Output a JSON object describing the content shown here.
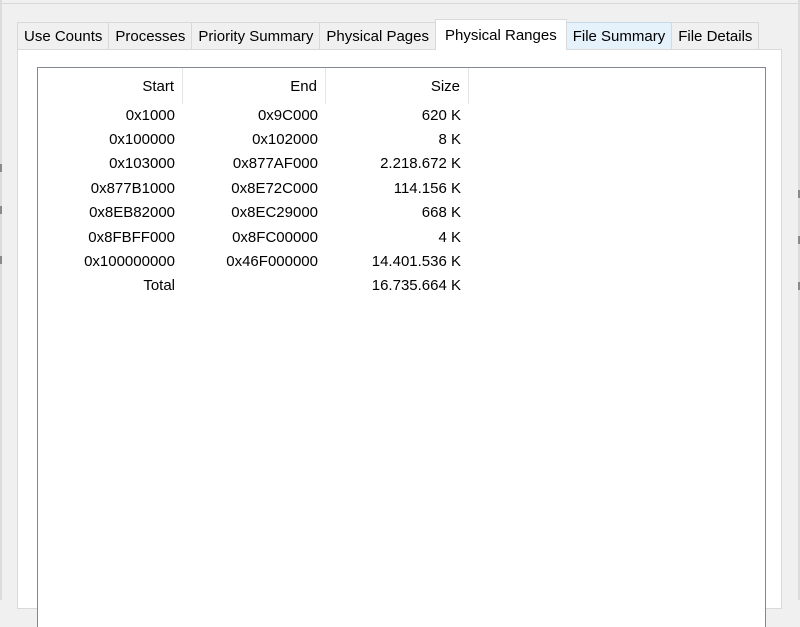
{
  "tabs": [
    {
      "label": "Use Counts"
    },
    {
      "label": "Processes"
    },
    {
      "label": "Priority Summary"
    },
    {
      "label": "Physical Pages"
    },
    {
      "label": "Physical Ranges"
    },
    {
      "label": "File Summary"
    },
    {
      "label": "File Details"
    }
  ],
  "active_tab": "Physical Ranges",
  "hover_tab": "File Summary",
  "table": {
    "columns": [
      "Start",
      "End",
      "Size"
    ],
    "rows": [
      [
        "0x1000",
        "0x9C000",
        "620 K"
      ],
      [
        "0x100000",
        "0x102000",
        "8 K"
      ],
      [
        "0x103000",
        "0x877AF000",
        "2.218.672 K"
      ],
      [
        "0x877B1000",
        "0x8E72C000",
        "114.156 K"
      ],
      [
        "0x8EB82000",
        "0x8EC29000",
        "668 K"
      ],
      [
        "0x8FBFF000",
        "0x8FC00000",
        "4 K"
      ],
      [
        "0x100000000",
        "0x46F000000",
        "14.401.536 K"
      ],
      [
        "Total",
        "",
        "16.735.664 K"
      ]
    ]
  }
}
